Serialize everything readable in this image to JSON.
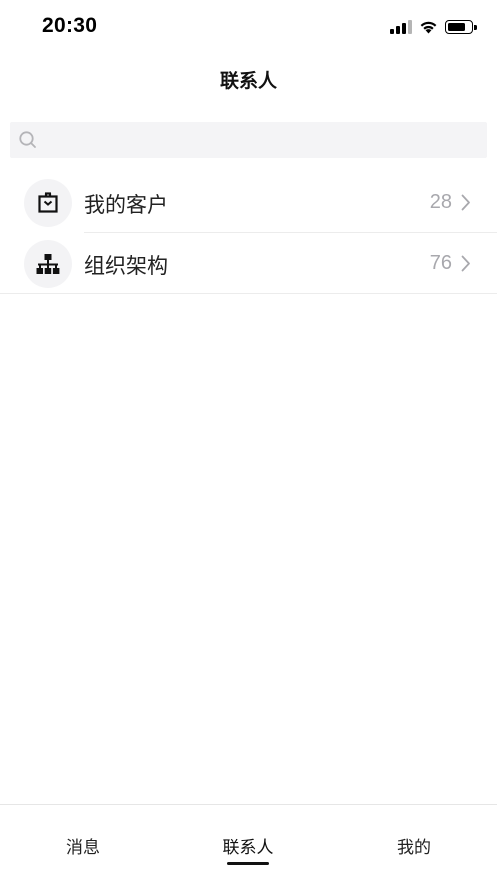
{
  "status_bar": {
    "time": "20:30",
    "icons": [
      "signal-icon",
      "wifi-icon",
      "battery-icon"
    ]
  },
  "nav": {
    "title": "联系人"
  },
  "search": {
    "placeholder": "",
    "icon": "search-icon"
  },
  "list": {
    "items": [
      {
        "label": "我的客户",
        "count": "28",
        "icon": "customer-bag-icon"
      },
      {
        "label": "组织架构",
        "count": "76",
        "icon": "org-chart-icon"
      }
    ]
  },
  "tabs": [
    {
      "label": "消息",
      "active": false
    },
    {
      "label": "联系人",
      "active": true
    },
    {
      "label": "我的",
      "active": false
    }
  ],
  "colors": {
    "count_gray": "#a8a8ad",
    "search_bg": "#f4f4f6",
    "avatar_bg": "#f3f3f5",
    "indicator": "#111111"
  }
}
